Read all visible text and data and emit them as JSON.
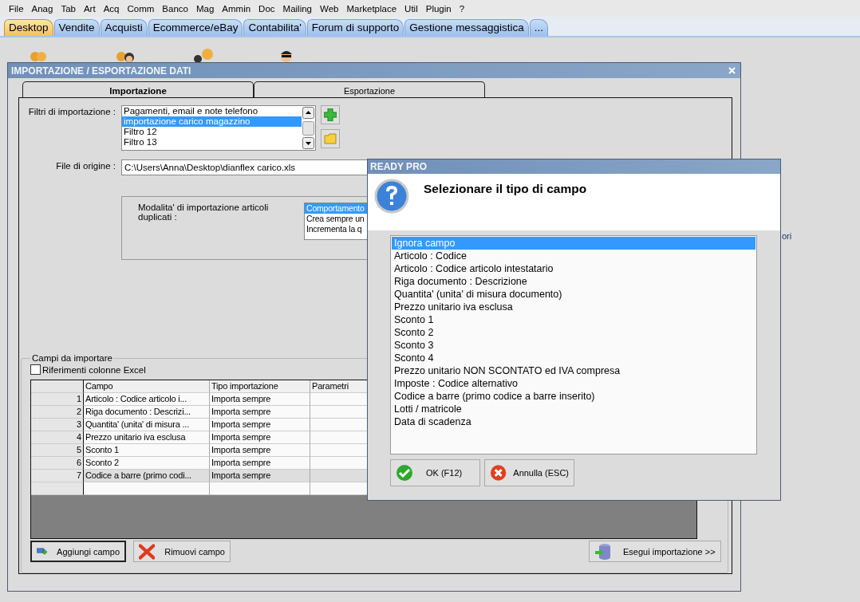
{
  "menu": [
    "File",
    "Anag",
    "Tab",
    "Art",
    "Acq",
    "Comm",
    "Banco",
    "Mag",
    "Ammin",
    "Doc",
    "Mailing",
    "Web",
    "Marketplace",
    "Util",
    "Plugin",
    "?"
  ],
  "tabs": [
    {
      "label": "Desktop",
      "selected": true
    },
    {
      "label": "Vendite",
      "selected": false
    },
    {
      "label": "Acquisti",
      "selected": false
    },
    {
      "label": "Ecommerce/eBay",
      "selected": false
    },
    {
      "label": "Contabilita'",
      "selected": false
    },
    {
      "label": "Forum di supporto",
      "selected": false
    },
    {
      "label": "Gestione messaggistica",
      "selected": false
    },
    {
      "label": "...",
      "selected": false
    }
  ],
  "desktop_fragment": "ori",
  "window": {
    "title": "IMPORTAZIONE / ESPORTAZIONE DATI",
    "tabs": [
      {
        "label": "Importazione",
        "selected": true
      },
      {
        "label": "Esportazione",
        "selected": false
      }
    ],
    "filters": {
      "label": "Filtri di importazione :",
      "items": [
        {
          "label": "Pagamenti, email e note telefono",
          "selected": false
        },
        {
          "label": "importazione carico magazzino",
          "selected": true
        },
        {
          "label": "Filtro 12",
          "selected": false
        },
        {
          "label": "Filtro 13",
          "selected": false
        }
      ]
    },
    "source_file": {
      "label": "File di origine :",
      "value": "C:\\Users\\Anna\\Desktop\\dianflex carico.xls"
    },
    "duplicates": {
      "label": "Modalita' di importazione articoli duplicati :",
      "items": [
        {
          "label": "Comportamento",
          "selected": true
        },
        {
          "label": "Crea sempre un",
          "selected": false
        },
        {
          "label": "Incrementa la q",
          "selected": false
        }
      ]
    },
    "fields": {
      "title": "Campi da importare",
      "excel_refs": {
        "label": "Riferimenti colonne Excel",
        "checked": false
      },
      "table": {
        "columns": [
          "Campo",
          "Tipo importazione",
          "Parametri"
        ],
        "rows": [
          {
            "number": "1",
            "campo": "Articolo : Codice articolo i...",
            "tipo": "Importa sempre",
            "selected": false
          },
          {
            "number": "2",
            "campo": "Riga documento : Descrizi...",
            "tipo": "Importa sempre",
            "selected": false
          },
          {
            "number": "3",
            "campo": "Quantita' (unita' di misura ...",
            "tipo": "Importa sempre",
            "selected": false
          },
          {
            "number": "4",
            "campo": "Prezzo unitario iva esclusa",
            "tipo": "Importa sempre",
            "selected": false
          },
          {
            "number": "5",
            "campo": "Sconto 1",
            "tipo": "Importa sempre",
            "selected": false
          },
          {
            "number": "6",
            "campo": "Sconto 2",
            "tipo": "Importa sempre",
            "selected": false
          },
          {
            "number": "7",
            "campo": "Codice a barre (primo codi...",
            "tipo": "Importa sempre",
            "selected": true
          }
        ]
      },
      "add_button": "Aggiungi campo",
      "remove_button": "Rimuovi campo",
      "run_button": "Esegui importazione >>"
    }
  },
  "dialog": {
    "title": "READY PRO",
    "heading": "Selezionare il tipo di campo",
    "options": [
      {
        "label": "Ignora campo",
        "selected": true
      },
      {
        "label": "Articolo : Codice",
        "selected": false
      },
      {
        "label": "Articolo : Codice articolo intestatario",
        "selected": false
      },
      {
        "label": "Riga documento : Descrizione",
        "selected": false
      },
      {
        "label": "Quantita' (unita' di misura documento)",
        "selected": false
      },
      {
        "label": "Prezzo unitario iva esclusa",
        "selected": false
      },
      {
        "label": "Sconto 1",
        "selected": false
      },
      {
        "label": "Sconto 2",
        "selected": false
      },
      {
        "label": "Sconto 3",
        "selected": false
      },
      {
        "label": "Sconto 4",
        "selected": false
      },
      {
        "label": "Prezzo unitario NON SCONTATO ed IVA compresa",
        "selected": false
      },
      {
        "label": "Imposte : Codice alternativo",
        "selected": false
      },
      {
        "label": "Codice a barre (primo codice a barre inserito)",
        "selected": false
      },
      {
        "label": "Lotti / matricole",
        "selected": false
      },
      {
        "label": "Data di scadenza",
        "selected": false
      }
    ],
    "ok_button": "OK (F12)",
    "cancel_button": "Annulla (ESC)"
  }
}
